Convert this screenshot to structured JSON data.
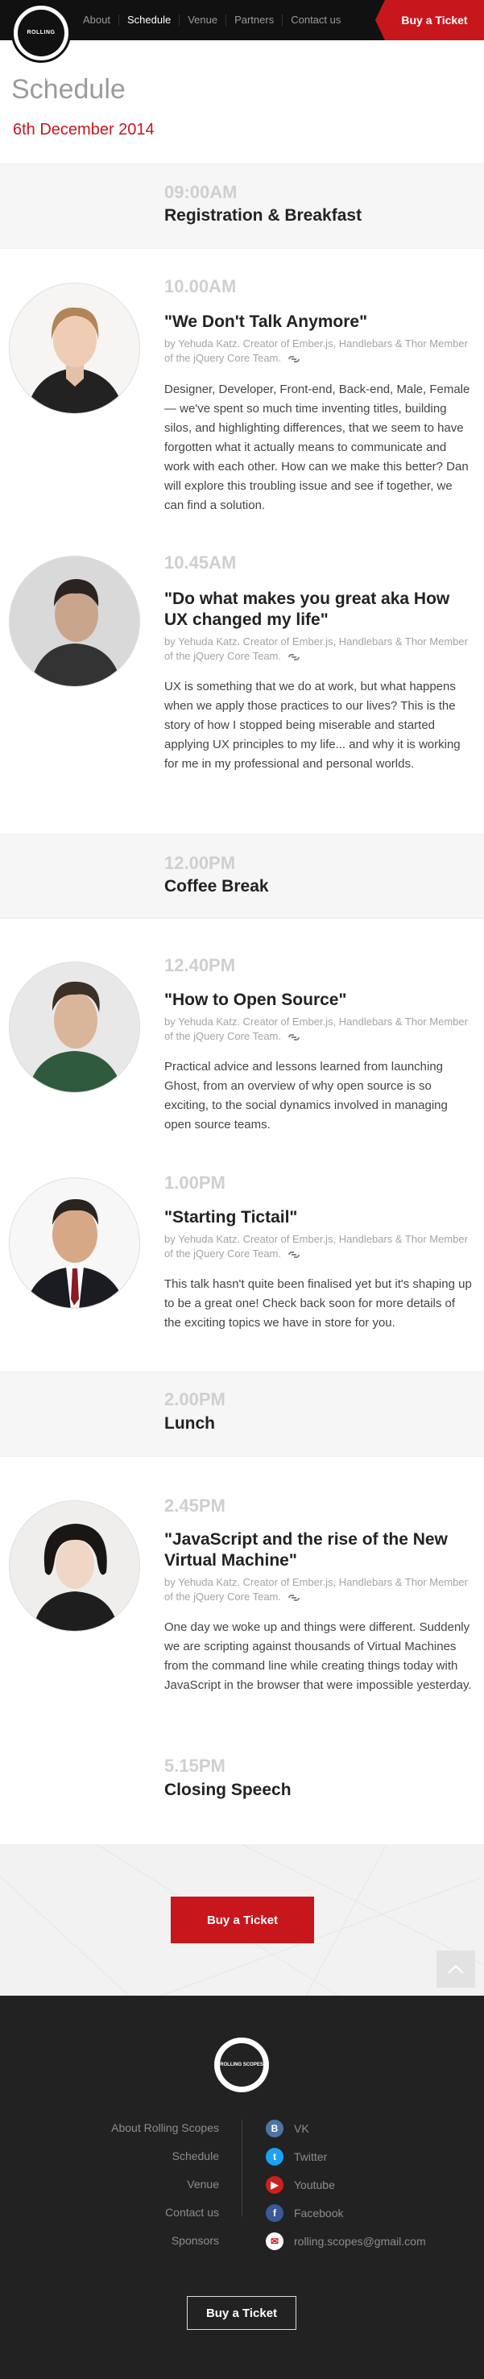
{
  "header": {
    "logo_text": "ROLLING SCOPES",
    "nav": [
      "About",
      "Schedule",
      "Venue",
      "Partners",
      "Contact us"
    ],
    "active_nav": "Schedule",
    "buy_label": "Buy a Ticket"
  },
  "page": {
    "title": "Schedule",
    "date": "6th December 2014"
  },
  "sessions": [
    {
      "time": "09:00AM",
      "title": "Registration & Breakfast"
    },
    {
      "time": "10.00AM",
      "title": "\"We Don't Talk Anymore\"",
      "meta": "by Yehuda Katz.   Creator of Ember.js, Handlebars & Thor Member of the jQuery Core Team.",
      "desc": "Designer, Developer, Front-end, Back-end, Male, Female — we've spent so much time inventing titles, building silos, and highlighting differences, that we seem to have forgotten what it actually means to communicate and work with each other. How can we make this better? Dan will explore this troubling issue and see if together, we can find a solution."
    },
    {
      "time": "10.45AM",
      "title": "\"Do what makes you great aka How UX changed my life\"",
      "meta": "by Yehuda Katz.   Creator of Ember.js, Handlebars & Thor Member of the jQuery Core Team.",
      "desc": "UX is something that we do at work, but what happens when we apply those practices to our lives? This is the story of how I stopped being miserable and started applying UX principles to my life... and why it is working for me in my professional and personal worlds."
    },
    {
      "time": "12.00PM",
      "title": "Coffee Break"
    },
    {
      "time": "12.40PM",
      "title": "\"How to Open Source\"",
      "meta": "by Yehuda Katz.   Creator of Ember.js, Handlebars & Thor Member of the jQuery Core Team.",
      "desc": "Practical advice and lessons learned from launching Ghost, from an overview of why open source is so exciting, to the social dynamics involved in managing open source teams."
    },
    {
      "time": "1.00PM",
      "title": "\"Starting Tictail\"",
      "meta": "by Yehuda Katz.   Creator of Ember.js, Handlebars & Thor Member of the jQuery Core Team.",
      "desc": "This talk hasn't quite been finalised yet but it's shaping up to be a great one! Check back soon for more details of the exciting topics we have in store for you."
    },
    {
      "time": "2.00PM",
      "title": "Lunch"
    },
    {
      "time": "2.45PM",
      "title": "\"JavaScript and the rise of the New Virtual Machine\"",
      "meta": "by Yehuda Katz.   Creator of Ember.js, Handlebars & Thor Member of the jQuery Core Team.",
      "desc": "One day we woke up and things were different. Suddenly we are scripting against thousands of Virtual Machines from the command line while creating things today with JavaScript in the browser that were impossible yesterday."
    },
    {
      "time": "5.15PM",
      "title": "Closing Speech"
    }
  ],
  "cta": {
    "buy_label": "Buy a Ticket"
  },
  "footer": {
    "logo_text": "ROLLING SCOPES",
    "links": [
      "About Rolling Scopes",
      "Schedule",
      "Venue",
      "Contact us",
      "Sponsors"
    ],
    "social": [
      {
        "label": "VK",
        "icon": "vk-icon",
        "color": "#4c75a3",
        "glyph": "B"
      },
      {
        "label": "Twitter",
        "icon": "twitter-icon",
        "color": "#1da1f2",
        "glyph": "t"
      },
      {
        "label": "Youtube",
        "icon": "youtube-icon",
        "color": "#cd201f",
        "glyph": "▶"
      },
      {
        "label": "Facebook",
        "icon": "facebook-icon",
        "color": "#3b5998",
        "glyph": "f"
      },
      {
        "label": "rolling.scopes@gmail.com",
        "icon": "email-icon",
        "color": "#c8161d",
        "glyph": "✉"
      }
    ],
    "buy_label": "Buy a Ticket"
  },
  "colors": {
    "accent": "#c8161d",
    "dark": "#111111",
    "footer": "#222222"
  }
}
